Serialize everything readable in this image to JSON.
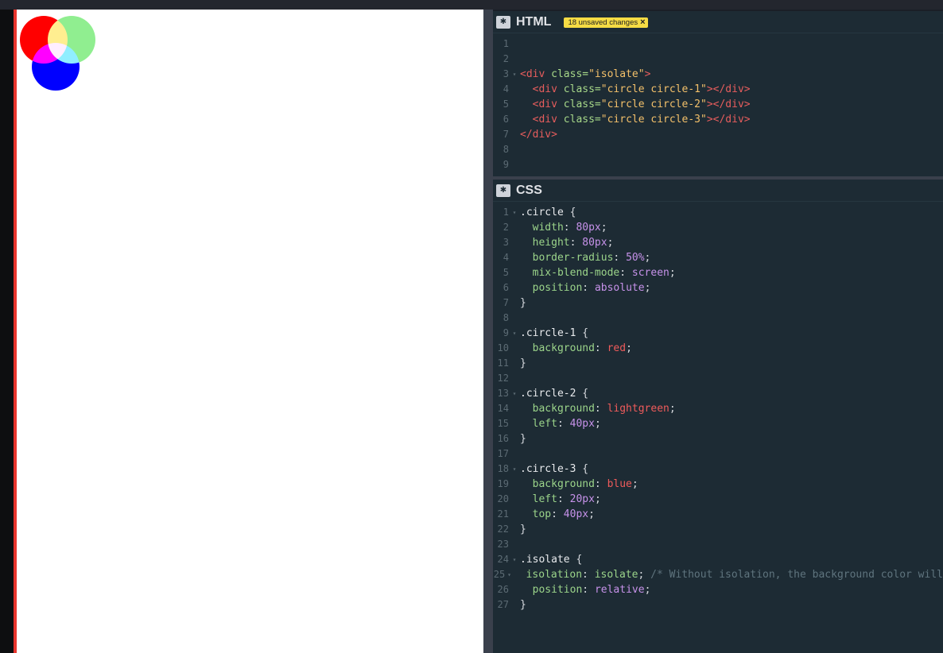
{
  "html_panel": {
    "title": "HTML",
    "badge": "18 unsaved changes",
    "lines": [
      {
        "n": "1",
        "fold": false,
        "tokens": []
      },
      {
        "n": "2",
        "fold": false,
        "tokens": []
      },
      {
        "n": "3",
        "fold": true,
        "tokens": [
          {
            "t": "<div ",
            "c": "tag"
          },
          {
            "t": "class=",
            "c": "attr"
          },
          {
            "t": "\"isolate\"",
            "c": "str"
          },
          {
            "t": ">",
            "c": "tag"
          }
        ]
      },
      {
        "n": "4",
        "fold": false,
        "tokens": [
          {
            "t": "  ",
            "c": "pun"
          },
          {
            "t": "<div ",
            "c": "tag"
          },
          {
            "t": "class=",
            "c": "attr"
          },
          {
            "t": "\"circle circle-1\"",
            "c": "str"
          },
          {
            "t": "></div>",
            "c": "tag"
          }
        ]
      },
      {
        "n": "5",
        "fold": false,
        "tokens": [
          {
            "t": "  ",
            "c": "pun"
          },
          {
            "t": "<div ",
            "c": "tag"
          },
          {
            "t": "class=",
            "c": "attr"
          },
          {
            "t": "\"circle circle-2\"",
            "c": "str"
          },
          {
            "t": "></div>",
            "c": "tag"
          }
        ]
      },
      {
        "n": "6",
        "fold": false,
        "tokens": [
          {
            "t": "  ",
            "c": "pun"
          },
          {
            "t": "<div ",
            "c": "tag"
          },
          {
            "t": "class=",
            "c": "attr"
          },
          {
            "t": "\"circle circle-3\"",
            "c": "str"
          },
          {
            "t": "></div>",
            "c": "tag"
          }
        ]
      },
      {
        "n": "7",
        "fold": false,
        "tokens": [
          {
            "t": "</div>",
            "c": "tag"
          }
        ]
      },
      {
        "n": "8",
        "fold": false,
        "tokens": []
      },
      {
        "n": "9",
        "fold": false,
        "tokens": []
      }
    ]
  },
  "css_panel": {
    "title": "CSS",
    "lines": [
      {
        "n": "1",
        "fold": true,
        "tokens": [
          {
            "t": ".circle ",
            "c": "sel"
          },
          {
            "t": "{",
            "c": "pun"
          }
        ]
      },
      {
        "n": "2",
        "fold": false,
        "tokens": [
          {
            "t": "  width",
            "c": "prop"
          },
          {
            "t": ": ",
            "c": "pun"
          },
          {
            "t": "80px",
            "c": "num"
          },
          {
            "t": ";",
            "c": "pun"
          }
        ]
      },
      {
        "n": "3",
        "fold": false,
        "tokens": [
          {
            "t": "  height",
            "c": "prop"
          },
          {
            "t": ": ",
            "c": "pun"
          },
          {
            "t": "80px",
            "c": "num"
          },
          {
            "t": ";",
            "c": "pun"
          }
        ]
      },
      {
        "n": "4",
        "fold": false,
        "tokens": [
          {
            "t": "  border-radius",
            "c": "prop"
          },
          {
            "t": ": ",
            "c": "pun"
          },
          {
            "t": "50%",
            "c": "num"
          },
          {
            "t": ";",
            "c": "pun"
          }
        ]
      },
      {
        "n": "5",
        "fold": false,
        "tokens": [
          {
            "t": "  mix-blend-mode",
            "c": "prop"
          },
          {
            "t": ": ",
            "c": "pun"
          },
          {
            "t": "screen",
            "c": "kw"
          },
          {
            "t": ";",
            "c": "pun"
          }
        ]
      },
      {
        "n": "6",
        "fold": false,
        "tokens": [
          {
            "t": "  position",
            "c": "prop"
          },
          {
            "t": ": ",
            "c": "pun"
          },
          {
            "t": "absolute",
            "c": "kw"
          },
          {
            "t": ";",
            "c": "pun"
          }
        ]
      },
      {
        "n": "7",
        "fold": false,
        "tokens": [
          {
            "t": "}",
            "c": "pun"
          }
        ]
      },
      {
        "n": "8",
        "fold": false,
        "tokens": []
      },
      {
        "n": "9",
        "fold": true,
        "tokens": [
          {
            "t": ".circle-1 ",
            "c": "sel"
          },
          {
            "t": "{",
            "c": "pun"
          }
        ]
      },
      {
        "n": "10",
        "fold": false,
        "tokens": [
          {
            "t": "  background",
            "c": "prop"
          },
          {
            "t": ": ",
            "c": "pun"
          },
          {
            "t": "red",
            "c": "col"
          },
          {
            "t": ";",
            "c": "pun"
          }
        ]
      },
      {
        "n": "11",
        "fold": false,
        "tokens": [
          {
            "t": "}",
            "c": "pun"
          }
        ]
      },
      {
        "n": "12",
        "fold": false,
        "tokens": []
      },
      {
        "n": "13",
        "fold": true,
        "tokens": [
          {
            "t": ".circle-2 ",
            "c": "sel"
          },
          {
            "t": "{",
            "c": "pun"
          }
        ]
      },
      {
        "n": "14",
        "fold": false,
        "tokens": [
          {
            "t": "  background",
            "c": "prop"
          },
          {
            "t": ": ",
            "c": "pun"
          },
          {
            "t": "lightgreen",
            "c": "col"
          },
          {
            "t": ";",
            "c": "pun"
          }
        ]
      },
      {
        "n": "15",
        "fold": false,
        "tokens": [
          {
            "t": "  left",
            "c": "prop"
          },
          {
            "t": ": ",
            "c": "pun"
          },
          {
            "t": "40px",
            "c": "num"
          },
          {
            "t": ";",
            "c": "pun"
          }
        ]
      },
      {
        "n": "16",
        "fold": false,
        "tokens": [
          {
            "t": "}",
            "c": "pun"
          }
        ]
      },
      {
        "n": "17",
        "fold": false,
        "tokens": []
      },
      {
        "n": "18",
        "fold": true,
        "tokens": [
          {
            "t": ".circle-3 ",
            "c": "sel"
          },
          {
            "t": "{",
            "c": "pun"
          }
        ]
      },
      {
        "n": "19",
        "fold": false,
        "tokens": [
          {
            "t": "  background",
            "c": "prop"
          },
          {
            "t": ": ",
            "c": "pun"
          },
          {
            "t": "blue",
            "c": "col"
          },
          {
            "t": ";",
            "c": "pun"
          }
        ]
      },
      {
        "n": "20",
        "fold": false,
        "tokens": [
          {
            "t": "  left",
            "c": "prop"
          },
          {
            "t": ": ",
            "c": "pun"
          },
          {
            "t": "20px",
            "c": "num"
          },
          {
            "t": ";",
            "c": "pun"
          }
        ]
      },
      {
        "n": "21",
        "fold": false,
        "tokens": [
          {
            "t": "  top",
            "c": "prop"
          },
          {
            "t": ": ",
            "c": "pun"
          },
          {
            "t": "40px",
            "c": "num"
          },
          {
            "t": ";",
            "c": "pun"
          }
        ]
      },
      {
        "n": "22",
        "fold": false,
        "tokens": [
          {
            "t": "}",
            "c": "pun"
          }
        ]
      },
      {
        "n": "23",
        "fold": false,
        "tokens": []
      },
      {
        "n": "24",
        "fold": true,
        "tokens": [
          {
            "t": ".isolate ",
            "c": "sel"
          },
          {
            "t": "{",
            "c": "pun"
          }
        ]
      },
      {
        "n": "25",
        "fold": true,
        "tokens": [
          {
            "t": "  isolation",
            "c": "prop"
          },
          {
            "t": ": ",
            "c": "pun"
          },
          {
            "t": "isolate",
            "c": "prop"
          },
          {
            "t": "; ",
            "c": "pun"
          },
          {
            "t": "/* Without isolation, the background color will",
            "c": "com"
          }
        ]
      },
      {
        "n": "26",
        "fold": false,
        "tokens": [
          {
            "t": "  position",
            "c": "prop"
          },
          {
            "t": ": ",
            "c": "pun"
          },
          {
            "t": "relative",
            "c": "kw"
          },
          {
            "t": ";",
            "c": "pun"
          }
        ]
      },
      {
        "n": "27",
        "fold": false,
        "tokens": [
          {
            "t": "}",
            "c": "pun"
          }
        ]
      }
    ]
  }
}
